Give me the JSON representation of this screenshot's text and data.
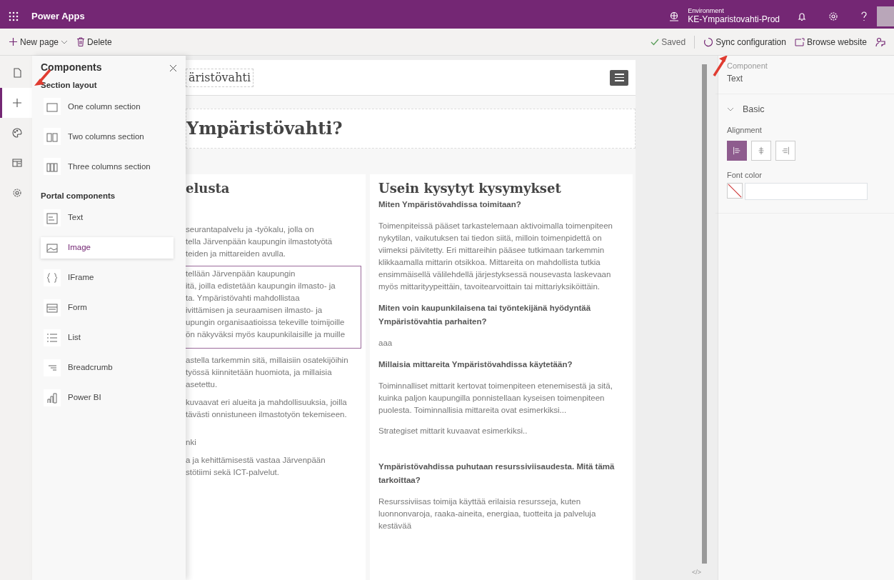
{
  "top_bar": {
    "app_title": "Power Apps",
    "environment_label": "Environment",
    "environment_name": "KE-Ymparistovahti-Prod"
  },
  "toolbar": {
    "new_page": "New page",
    "delete": "Delete",
    "saved": "Saved",
    "sync": "Sync configuration",
    "browse": "Browse website"
  },
  "rail": [
    {
      "kind": "page",
      "selected": false
    },
    {
      "kind": "add",
      "selected": true
    },
    {
      "kind": "theme",
      "selected": false
    },
    {
      "kind": "template",
      "selected": false
    },
    {
      "kind": "settings",
      "selected": false
    }
  ],
  "components_panel": {
    "title": "Components",
    "sections": [
      {
        "heading": "Section layout",
        "items": [
          {
            "kind": "one-col",
            "label": "One column section",
            "highlighted": false
          },
          {
            "kind": "two-col",
            "label": "Two columns section",
            "highlighted": false
          },
          {
            "kind": "three-col",
            "label": "Three columns section",
            "highlighted": false
          }
        ]
      },
      {
        "heading": "Portal components",
        "items": [
          {
            "kind": "text",
            "label": "Text",
            "highlighted": false
          },
          {
            "kind": "image",
            "label": "Image",
            "highlighted": true
          },
          {
            "kind": "iframe",
            "label": "IFrame",
            "highlighted": false
          },
          {
            "kind": "form",
            "label": "Form",
            "highlighted": false
          },
          {
            "kind": "list",
            "label": "List",
            "highlighted": false
          },
          {
            "kind": "breadcrumb",
            "label": "Breadcrumb",
            "highlighted": false
          },
          {
            "kind": "powerbi",
            "label": "Power BI",
            "highlighted": false
          }
        ]
      }
    ]
  },
  "canvas": {
    "logo_text": "äristövahti",
    "headline": "Ympäristövahti?",
    "left_column": {
      "heading": "elusta",
      "paragraphs": [
        {
          "selected": false,
          "lines": [
            "seurantapalvelu ja -työkalu, jolla on",
            "tella Järvenpään kaupungin ilmastotyötä",
            "teiden ja mittareiden avulla."
          ]
        },
        {
          "selected": true,
          "lines": [
            "tellään Järvenpään kaupungin",
            "itä, joilla edistetään kaupungin ilmasto- ja",
            "ta. Ympäristövahti mahdollistaa",
            "ivittämisen ja seuraamisen ilmasto- ja",
            "upungin organisaatioissa tekeville toimijoille",
            "ön näkyväksi myös kaupunkilaisille ja muille"
          ]
        },
        {
          "selected": false,
          "lines": [
            "astella tarkemmin sitä, millaisiin osatekijöihin",
            "työssä kiinnitetään huomiota, ja millaisia",
            "asetettu."
          ]
        },
        {
          "selected": false,
          "lines": [
            "kuvaavat eri alueita ja mahdollisuuksia, joilla",
            "tävästi onnistuneen ilmastotyön tekemiseen."
          ]
        },
        {
          "selected": false,
          "lines": [
            "nki"
          ]
        },
        {
          "selected": false,
          "lines": [
            "a ja kehittämisestä vastaa Järvenpään",
            "stötiimi sekä ICT-palvelut."
          ]
        }
      ]
    },
    "faq": {
      "heading": "Usein kysytyt kysymykset",
      "items": [
        {
          "question": "Miten Ympäristövahdissa toimitaan?",
          "answers": [
            "Toimenpiteissä pääset tarkastelemaan aktivoimalla toimenpiteen nykytilan, vaikutuksen tai tiedon siitä, milloin toimenpidettä on viimeksi päivitetty. Eri mittareihin pääsee tutkimaan tarkemmin klikkaamalla mittarin otsikkoa. Mittareita on mahdollista tutkia ensimmäisellä välilehdellä järjestyksessä nousevasta laskevaan myös mittarityypeittäin, tavoitearvoittain tai mittariyksiköittäin."
          ]
        },
        {
          "question": "Miten voin kaupunkilaisena tai työntekijänä hyödyntää Ympäristövahtia parhaiten?",
          "answers": [
            "aaa"
          ]
        },
        {
          "question": "Millaisia mittareita Ympäristövahdissa käytetään?",
          "answers": [
            "Toiminnalliset mittarit kertovat toimenpiteen etenemisestä ja sitä, kuinka paljon kaupungilla ponnistellaan kyseisen toimenpiteen puolesta. Toiminnallisia mittareita ovat esimerkiksi...",
            "Strategiset mittarit kuvaavat esimerkiksi.."
          ]
        },
        {
          "question": "Ympäristövahdissa puhutaan resurssiviisaudesta. Mitä tämä tarkoittaa?",
          "answers": [
            "Resurssiviisas toimija käyttää erilaisia resursseja, kuten luonnonvaroja, raaka-aineita, energiaa, tuotteita ja palveluja kestävää"
          ]
        }
      ]
    },
    "code_toggle": "</>"
  },
  "properties": {
    "label": "Component",
    "component": "Text",
    "section": "Basic",
    "expanded": true,
    "alignment_label": "Alignment",
    "alignments": [
      {
        "kind": "left",
        "selected": true
      },
      {
        "kind": "center",
        "selected": false
      },
      {
        "kind": "right",
        "selected": false
      }
    ],
    "font_color_label": "Font color"
  }
}
